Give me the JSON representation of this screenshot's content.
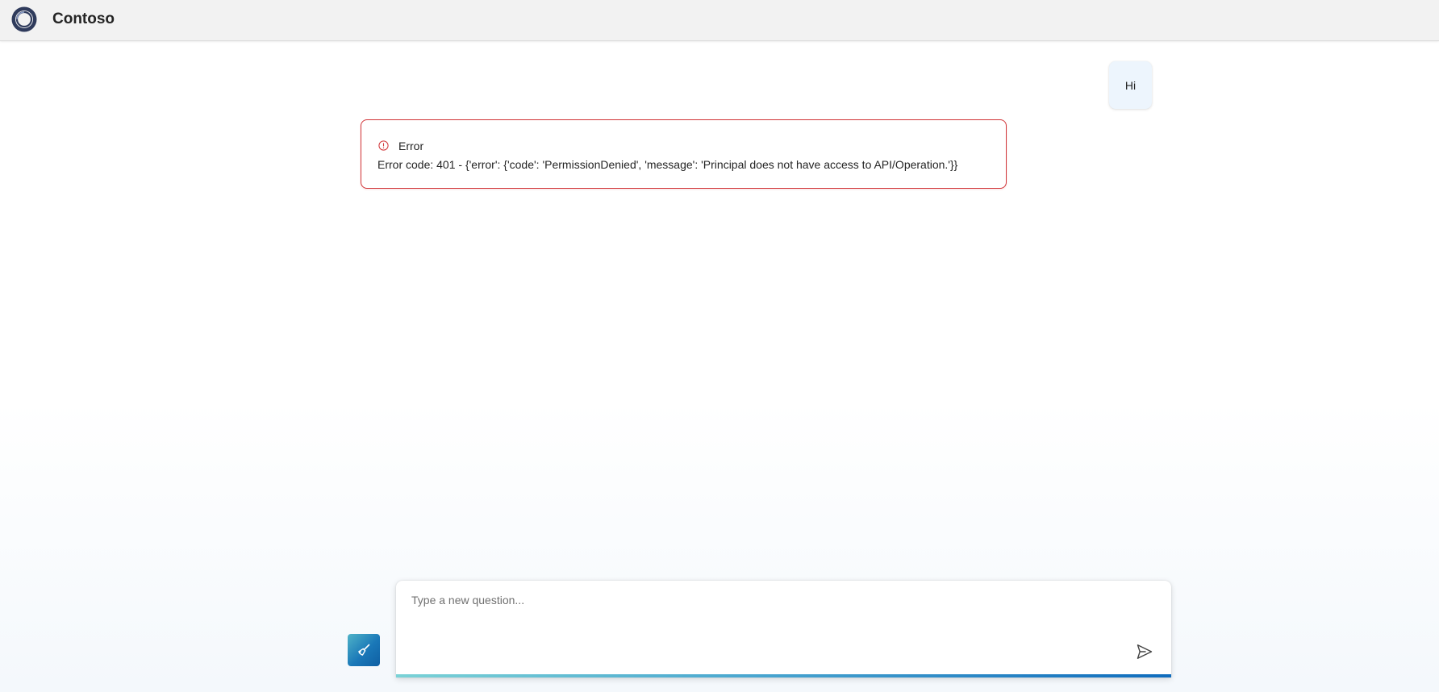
{
  "header": {
    "title": "Contoso",
    "logo_icon": "contoso-ring-logo",
    "background_color": "#f2f2f2"
  },
  "conversation": {
    "user_message": "Hi",
    "error": {
      "icon": "error-circle-icon",
      "title": "Error",
      "message": "Error code: 401 - {'error': {'code': 'PermissionDenied', 'message': 'Principal does not have access to API/Operation.'}}",
      "border_color": "#d13438"
    }
  },
  "composer": {
    "placeholder": "Type a new question...",
    "value": "",
    "clear_button_icon": "broom-icon",
    "send_button_icon": "send-icon",
    "accent_color": "#0f6cbd"
  }
}
